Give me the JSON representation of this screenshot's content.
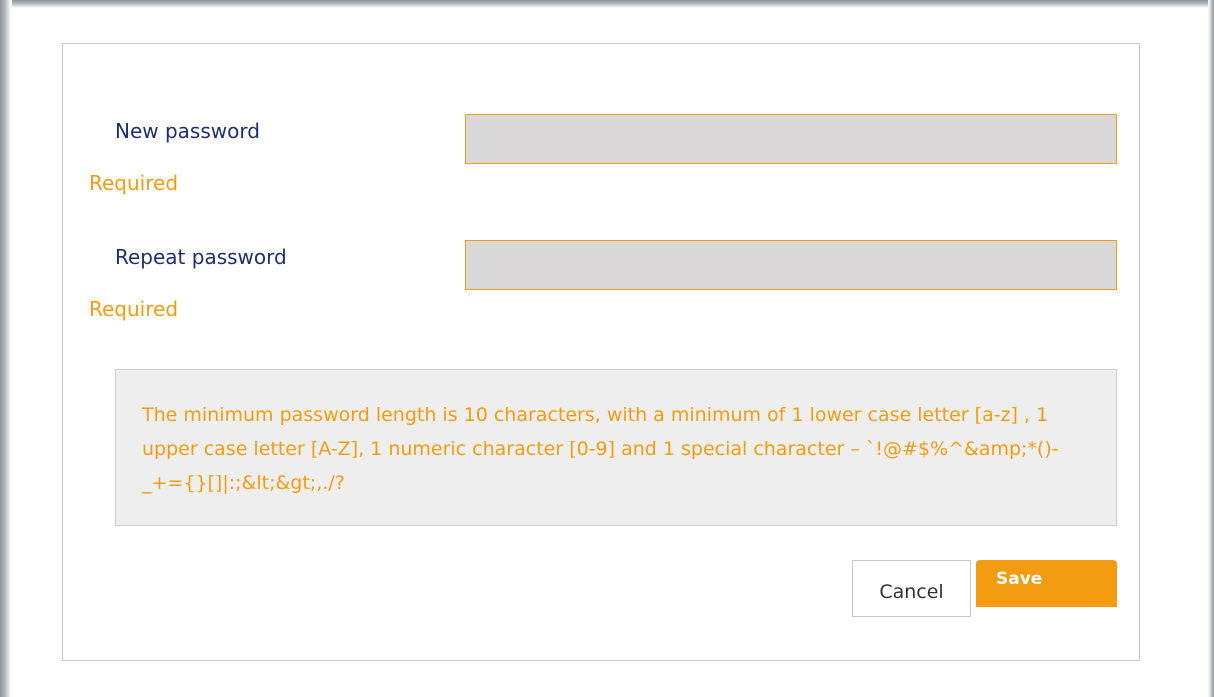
{
  "form": {
    "new_password": {
      "label": "New password",
      "value": "",
      "error": "Required"
    },
    "repeat_password": {
      "label": "Repeat password",
      "value": "",
      "error": "Required"
    },
    "hint": "The minimum password length is 10 characters, with a minimum of 1 lower case letter [a-z] , 1 upper case letter [A-Z], 1 numeric character [0-9] and 1 special character – `!@#$%^&amp;*()-_+={}[]|:;&lt;&gt;,./?"
  },
  "buttons": {
    "cancel_label": "Cancel",
    "save_label": "Save"
  },
  "colors": {
    "accent": "#f39c12",
    "label": "#1f2f6b",
    "input_bg": "#d9d7d8",
    "hint_bg": "#eeeeee"
  }
}
